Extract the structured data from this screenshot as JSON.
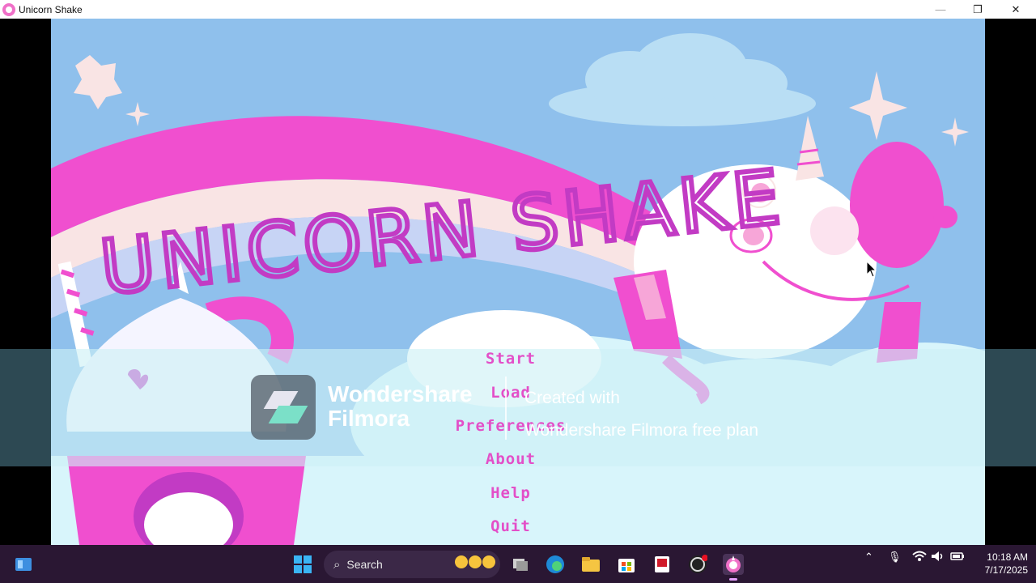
{
  "window": {
    "title": "Unicorn Shake",
    "controls": {
      "minimize": "—",
      "maximize": "❐",
      "close": "✕"
    }
  },
  "game": {
    "logo_text": "UNICORN SHAKE",
    "menu": [
      {
        "label": "Start"
      },
      {
        "label": "Load"
      },
      {
        "label": "Preferences"
      },
      {
        "label": "About"
      },
      {
        "label": "Help"
      },
      {
        "label": "Quit"
      }
    ]
  },
  "watermark": {
    "brand_line1": "Wondershare",
    "brand_line2": "Filmora",
    "note_line1": "Created with",
    "note_line2": "Wondershare Filmora free plan"
  },
  "taskbar": {
    "search_label": "Search",
    "apps": [
      "start-icon",
      "task-view-icon",
      "edge-icon",
      "file-explorer-icon",
      "store-icon",
      "media-app-icon",
      "obs-icon",
      "unicorn-shake-icon"
    ],
    "clock_time": "10:18 AM",
    "clock_date": "7/17/2025"
  },
  "colors": {
    "sky": "#8fc0ec",
    "rainbow_pink": "#f04fcf",
    "title_magenta": "#c23bc4",
    "menu_text": "#e34fc8",
    "taskbar": "#2a1733"
  }
}
